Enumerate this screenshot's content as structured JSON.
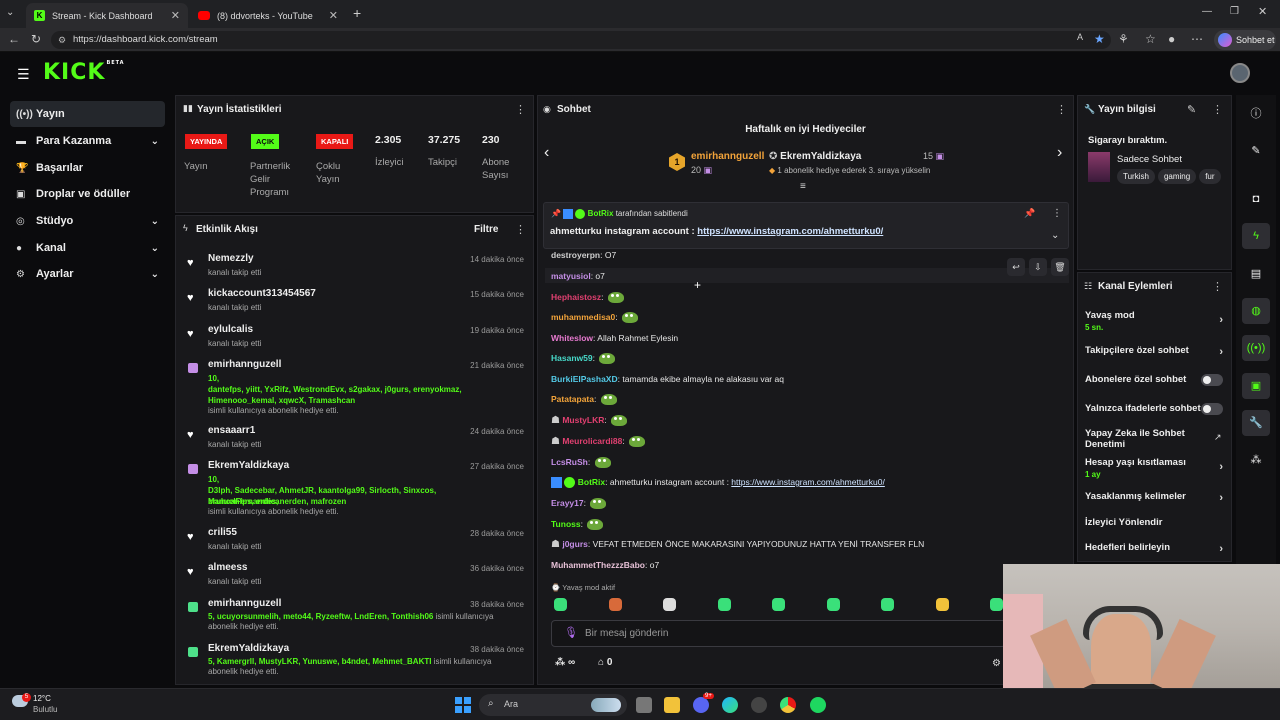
{
  "browser": {
    "tabs": [
      {
        "title": "Stream - Kick Dashboard",
        "active": true
      },
      {
        "title": "(8) ddvorteks - YouTube",
        "active": false
      }
    ],
    "url": "https://dashboard.kick.com/stream",
    "profile_label": "Sohbet et"
  },
  "kick": {
    "logo": "KICK",
    "logo_badge": "BETA"
  },
  "sidebar": {
    "items": [
      {
        "label": "Yayın",
        "icon": "broadcast-icon",
        "active": true
      },
      {
        "label": "Para Kazanma",
        "icon": "dollar-icon",
        "expandable": true
      },
      {
        "label": "Başarılar",
        "icon": "trophy-icon"
      },
      {
        "label": "Droplar ve ödüller",
        "icon": "gift-icon"
      },
      {
        "label": "Stüdyo",
        "icon": "target-icon",
        "expandable": true
      },
      {
        "label": "Kanal",
        "icon": "user-icon",
        "expandable": true
      },
      {
        "label": "Ayarlar",
        "icon": "gear-icon",
        "expandable": true
      }
    ]
  },
  "stats": {
    "title": "Yayın İstatistikleri",
    "badges": [
      {
        "badge": "YAYINDA",
        "label": "Yayın",
        "color": "#e91916"
      },
      {
        "badge": "AÇIK",
        "label": "Partnerlik Gelir Programı",
        "color": "#53fc18"
      },
      {
        "badge": "KAPALI",
        "label": "Çoklu Yayın",
        "color": "#e91916"
      }
    ],
    "numbers": [
      {
        "value": "2.305",
        "label": "İzleyici"
      },
      {
        "value": "37.275",
        "label": "Takipçi"
      },
      {
        "value": "230",
        "label": "Abone Sayısı"
      }
    ]
  },
  "activity": {
    "title": "Etkinlik Akışı",
    "filter_label": "Filtre",
    "items": [
      {
        "type": "follow",
        "name": "Nemezzly",
        "time": "14 dakika önce",
        "text": "kanalı takip etti"
      },
      {
        "type": "follow",
        "name": "kickaccount313454567",
        "time": "15 dakika önce",
        "text": "kanalı takip etti"
      },
      {
        "type": "follow",
        "name": "eylulcalis",
        "time": "19 dakika önce",
        "text": "kanalı takip etti"
      },
      {
        "type": "gift",
        "name": "emirhannguzell",
        "time": "21 dakika önce",
        "lines": [
          "10,",
          "dantefps, yiitt, YxRifz, WestrondEvx, s2gakax, j0gurs, erenyokmaz,",
          "Himenooo_kemal, xqwcX, Tramashcan"
        ],
        "text": "isimli kullanıcıya abonelik hediye etti."
      },
      {
        "type": "follow",
        "name": "ensaaarr1",
        "time": "24 dakika önce",
        "text": "kanalı takip etti"
      },
      {
        "type": "gift",
        "name": "EkremYaldizkaya",
        "time": "27 dakika önce",
        "lines": [
          "10,",
          "D3lph, Sadecebar, AhmetJR, kaantolga99, Sirlocth, Sinxcos, ManuelFernandes,",
          "bruhcanfps, erdicanerden, mafrozen"
        ],
        "text": "isimli kullanıcıya abonelik hediye etti."
      },
      {
        "type": "follow",
        "name": "crili55",
        "time": "28 dakika önce",
        "text": "kanalı takip etti"
      },
      {
        "type": "follow",
        "name": "almeess",
        "time": "36 dakika önce",
        "text": "kanalı takip etti"
      },
      {
        "type": "gift2",
        "name": "emirhannguzell",
        "time": "38 dakika önce",
        "lines": [
          "5, ucuyorsunmelih, meto44, Ryzeeftw, LndEren, Tonthish06"
        ],
        "tail": "isimli kullanıcıya",
        "text": "abonelik hediye etti."
      },
      {
        "type": "gift2",
        "name": "EkremYaldizkaya",
        "time": "38 dakika önce",
        "lines": [
          "5, Kamergrll, MustyLKR, Yunuswe, b4ndet, Mehmet_BAKTI"
        ],
        "tail": "isimli kullanıcıya",
        "text": "abonelik hediye etti."
      }
    ]
  },
  "chat": {
    "title": "Sohbet",
    "gifters_title": "Haftalık en iyi Hediyeciler",
    "top1": {
      "rank": "1",
      "name": "emirhannguzell",
      "count": "20"
    },
    "top2": {
      "name": "EkremYaldizkaya",
      "count": "15",
      "note": "1 abonelik hediye ederek 3. sıraya yükselin"
    },
    "pinned": {
      "by_user": "BotRix",
      "by_text": "tarafından sabitlendi",
      "prefix": "ahmetturku instagram account : ",
      "link": "https://www.instagram.com/ahmetturku0/"
    },
    "messages": [
      {
        "user": "destroyerpn",
        "color": "#cfcfcf",
        "text": "O7"
      },
      {
        "user": "matyusiol",
        "color": "#c48ee6",
        "text": "o7"
      },
      {
        "user": "Hephaistosz",
        "color": "#e04070",
        "text": "",
        "emote": true
      },
      {
        "user": "muhammedisa0",
        "color": "#f2a33a",
        "text": "",
        "emote": true
      },
      {
        "user": "Whiteslow",
        "color": "#e87ad0",
        "text": "Allah Rahmet Eylesin"
      },
      {
        "user": "Hasanw59",
        "color": "#47d9c9",
        "text": "",
        "emote": true
      },
      {
        "user": "BurkiElPashaXD",
        "color": "#53c9e6",
        "text": "tamamda ekibe almayla ne alakasıu var aq"
      },
      {
        "user": "Patatapata",
        "color": "#f2a33a",
        "text": "",
        "emote": true
      },
      {
        "user": "MustyLKR",
        "color": "#e04070",
        "text": "",
        "emote": true,
        "badge": true
      },
      {
        "user": "Meurolicardi88",
        "color": "#e04070",
        "text": "",
        "emote": true,
        "badge": true
      },
      {
        "user": "LcsRuSh",
        "color": "#c48ee6",
        "text": "",
        "emote": true
      },
      {
        "user": "BotRix",
        "color": "#53fc18",
        "text": "ahmetturku instagram account : ",
        "link": "https://www.instagram.com/ahmetturku0/",
        "bot": true
      },
      {
        "user": "Erayy17",
        "color": "#c48ee6",
        "text": "",
        "emote": true
      },
      {
        "user": "Tunoss",
        "color": "#53fc18",
        "text": "",
        "emote": true
      },
      {
        "user": "j0gurs",
        "color": "#c48ee6",
        "text": "VEFAT ETMEDEN ÖNCE MAKARASINI YAPIYODUNUZ HATTA YENİ TRANSFER FLN",
        "badge": true
      },
      {
        "user": "MuhammetThezzzBabo",
        "color": "#e6c0d6",
        "text": "o7"
      }
    ],
    "slow_mode": "Yavaş mod aktif",
    "input_placeholder": "Bir mesaj gönderin",
    "footer_count": "∞",
    "footer_store": "0"
  },
  "stream_info": {
    "title": "Yayın bilgisi",
    "stream_title": "Sigarayı bıraktım.",
    "category": "Sadece Sohbet",
    "tags": [
      "Turkish",
      "gaming",
      "fur"
    ]
  },
  "channel_actions": {
    "title": "Kanal Eylemleri",
    "items": [
      {
        "label": "Yavaş mod",
        "sub": "5 sn.",
        "control": "chevron"
      },
      {
        "label": "Takipçilere özel sohbet",
        "control": "chevron"
      },
      {
        "label": "Abonelere özel sohbet",
        "control": "toggle"
      },
      {
        "label": "Yalnızca ifadelerle sohbet",
        "control": "toggle"
      },
      {
        "label": "Yapay Zeka ile Sohbet Denetimi",
        "control": "external"
      },
      {
        "label": "Hesap yaşı kısıtlaması",
        "sub": "1 ay",
        "control": "chevron"
      },
      {
        "label": "Yasaklanmış kelimeler",
        "control": "chevron"
      },
      {
        "label": "İzleyici Yönlendir",
        "control": "none"
      },
      {
        "label": "Hedefleri belirleyin",
        "control": "chevron"
      }
    ]
  },
  "taskbar": {
    "weather_temp": "12°C",
    "weather_text": "Bulutlu",
    "search": "Ara",
    "notif_count": "9+"
  },
  "colors": {
    "kick_green": "#53fc18",
    "live_red": "#e91916",
    "panel": "#18181b"
  }
}
